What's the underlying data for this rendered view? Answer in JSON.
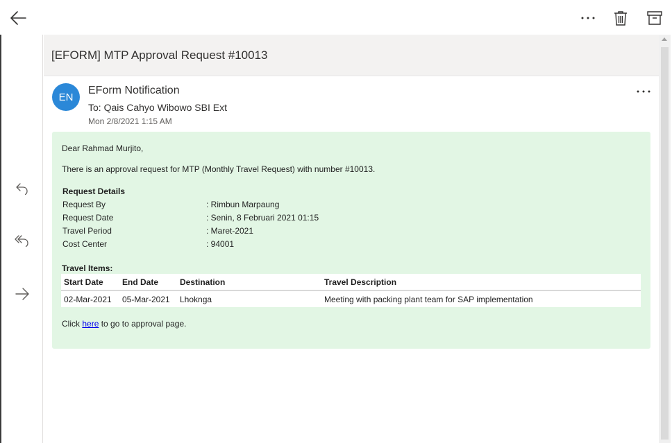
{
  "toolbar": {
    "back_icon": "arrow-left-icon",
    "more_icon": "more-horizontal-icon",
    "delete_icon": "trash-icon",
    "archive_icon": "archive-icon"
  },
  "rail": {
    "reply_icon": "reply-icon",
    "reply_all_icon": "reply-all-icon",
    "forward_icon": "forward-icon"
  },
  "email": {
    "subject": "[EFORM] MTP Approval Request #10013",
    "avatar_initials": "EN",
    "avatar_color": "#2b88d8",
    "sender": "EForm Notification",
    "recipient": "To: Qais Cahyo Wibowo SBI Ext",
    "date": "Mon 2/8/2021 1:15 AM",
    "body_background": "#e2f6e4",
    "greeting": "Dear Rahmad Murjito,",
    "intro": "There is an approval request for MTP (Monthly Travel Request) with number #10013.",
    "details_title": "Request Details",
    "details": [
      {
        "label": "Request By",
        "value": ": Rimbun Marpaung"
      },
      {
        "label": "Request Date",
        "value": ": Senin, 8 Februari 2021 01:15"
      },
      {
        "label": "Travel Period",
        "value": ": Maret-2021"
      },
      {
        "label": "Cost Center",
        "value": ": 94001"
      }
    ],
    "items_title": "Travel Items:",
    "items_columns": [
      "Start Date",
      "End Date",
      "Destination",
      "Travel Description"
    ],
    "items_rows": [
      [
        "02-Mar-2021",
        "05-Mar-2021",
        "Lhoknga",
        "Meeting with packing plant team for SAP implementation"
      ]
    ],
    "click_prefix": "Click ",
    "link_text": "here",
    "click_suffix": " to go to approval page."
  }
}
